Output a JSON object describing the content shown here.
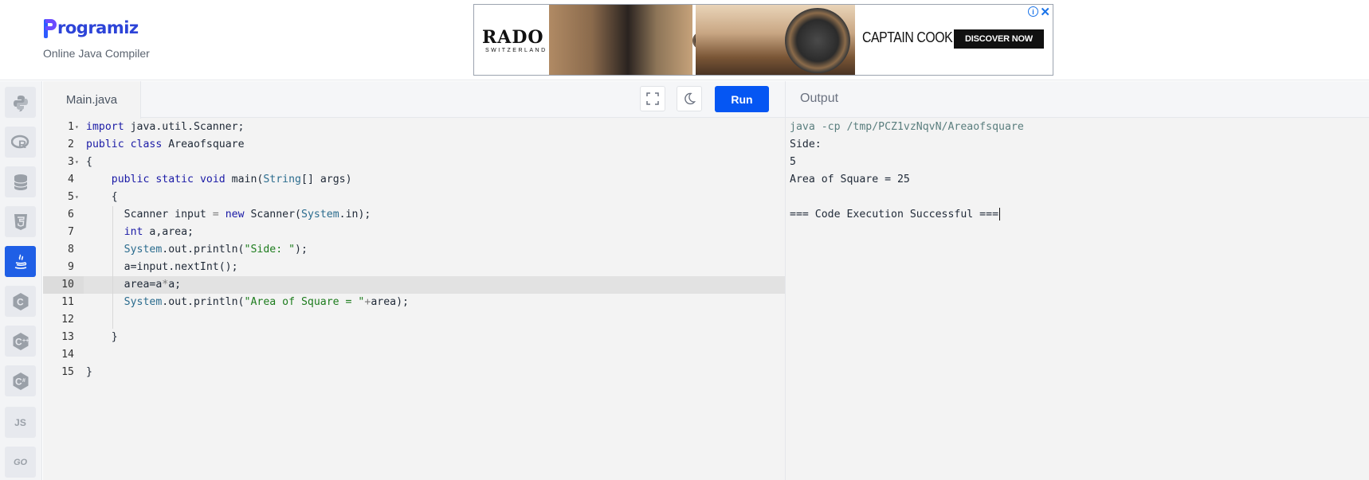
{
  "header": {
    "logo_text": "rogramiz",
    "logo_full": "Programiz",
    "subtitle": "Online Java Compiler"
  },
  "ad": {
    "brand": "RADO",
    "brand_sub": "SWITZERLAND",
    "product": "CAPTAIN COOK",
    "cta": "DISCOVER NOW",
    "info_icon": "info-icon",
    "close_icon": "close-icon"
  },
  "sidebar": {
    "items": [
      {
        "name": "python",
        "icon": "python-icon"
      },
      {
        "name": "r",
        "icon": "r-icon"
      },
      {
        "name": "sql",
        "icon": "database-icon"
      },
      {
        "name": "html",
        "icon": "html5-icon"
      },
      {
        "name": "java",
        "icon": "java-icon",
        "active": true
      },
      {
        "name": "c",
        "icon": "c-icon"
      },
      {
        "name": "cpp",
        "icon": "cpp-icon"
      },
      {
        "name": "csharp",
        "icon": "csharp-icon"
      },
      {
        "name": "js",
        "label": "JS",
        "icon": "js-icon"
      },
      {
        "name": "go",
        "label": "GO",
        "icon": "go-icon"
      }
    ]
  },
  "editor": {
    "file_tab": "Main.java",
    "run_label": "Run",
    "fullscreen_icon": "fullscreen-icon",
    "theme_icon": "moon-icon",
    "highlighted_line": 10,
    "lines": [
      {
        "n": "1",
        "fold": true
      },
      {
        "n": "2"
      },
      {
        "n": "3",
        "fold": true
      },
      {
        "n": "4"
      },
      {
        "n": "5",
        "fold": true
      },
      {
        "n": "6"
      },
      {
        "n": "7"
      },
      {
        "n": "8"
      },
      {
        "n": "9"
      },
      {
        "n": "10"
      },
      {
        "n": "11"
      },
      {
        "n": "12"
      },
      {
        "n": "13"
      },
      {
        "n": "14"
      },
      {
        "n": "15"
      }
    ],
    "code": {
      "l1_kw": "import",
      "l1_rest": " java.util.Scanner;",
      "l2_kw1": "public",
      "l2_kw2": "class",
      "l2_rest": " Areaofsquare",
      "l3": "{",
      "l4_kw1": "public",
      "l4_kw2": "static",
      "l4_kw3": "void",
      "l4_mid": " main(",
      "l4_cls": "String",
      "l4_rest": "[] args)",
      "l5": "{",
      "l6_a": "Scanner input ",
      "l6_eq": "=",
      "l6_kw": "new",
      "l6_b": " Scanner(",
      "l6_cls": "System",
      "l6_c": ".in);",
      "l7_kw": "int",
      "l7_rest": " a,area;",
      "l8_cls": "System",
      "l8_mid": ".out.println(",
      "l8_str": "\"Side: \"",
      "l8_rest": ");",
      "l9": "a=input.nextInt();",
      "l10_a": "area=a",
      "l10_op": "*",
      "l10_b": "a;",
      "l11_cls": "System",
      "l11_mid": ".out.println(",
      "l11_str": "\"Area of Square = \"",
      "l11_op": "+",
      "l11_rest": "area);",
      "l13": "}",
      "l15": "}"
    }
  },
  "output": {
    "title": "Output",
    "lines": [
      "java -cp /tmp/PCZ1vzNqvN/Areaofsquare",
      "Side: ",
      "5",
      "Area of Square = 25",
      "",
      "=== Code Execution Successful ==="
    ]
  }
}
